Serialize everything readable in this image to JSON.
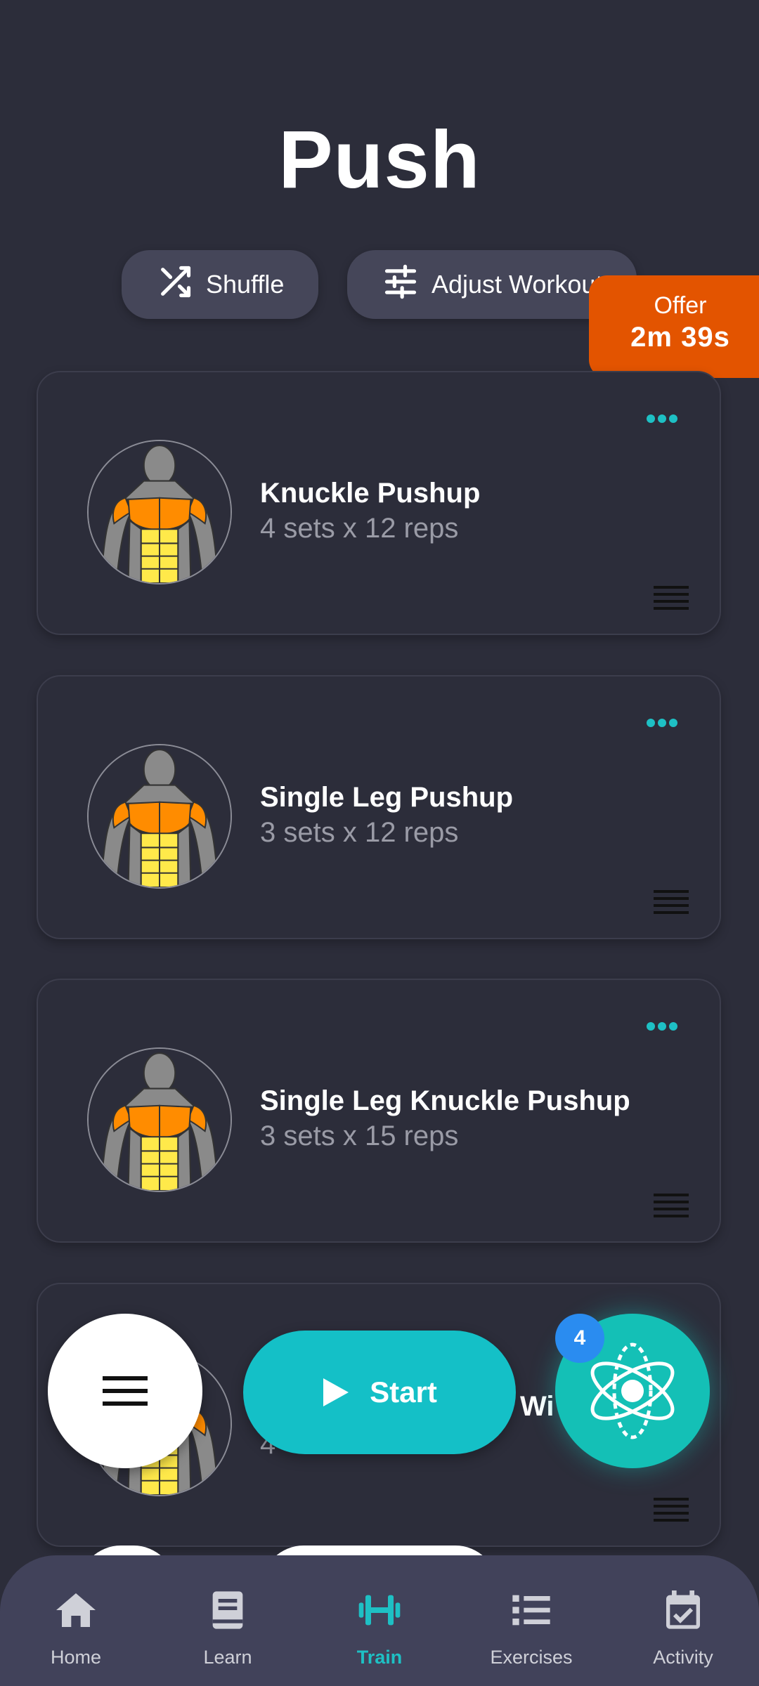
{
  "page": {
    "title": "Push"
  },
  "actions": {
    "shuffle_label": "Shuffle",
    "adjust_label": "Adjust Workout"
  },
  "offer": {
    "label": "Offer",
    "timer": "2m  39s"
  },
  "exercises": [
    {
      "name": "Knuckle Pushup",
      "detail": "4 sets x 12 reps"
    },
    {
      "name": "Single Leg Pushup",
      "detail": "3 sets x 12 reps"
    },
    {
      "name": "Single Leg Knuckle Pushup",
      "detail": "3 sets x 15 reps"
    },
    {
      "name": "Wi",
      "detail": "4"
    }
  ],
  "fab": {
    "start_label": "Start",
    "badge_count": "4"
  },
  "bottom_nav": {
    "items": [
      {
        "label": "Home",
        "icon": "home-icon"
      },
      {
        "label": "Learn",
        "icon": "book-icon"
      },
      {
        "label": "Train",
        "icon": "dumbbell-icon",
        "active": true
      },
      {
        "label": "Exercises",
        "icon": "list-icon"
      },
      {
        "label": "Activity",
        "icon": "calendar-check-icon"
      }
    ]
  },
  "colors": {
    "background": "#2c2d3a",
    "accent": "#14c0c7",
    "offer": "#e35400",
    "badge": "#2a8cf0",
    "nav_background": "#41425a"
  }
}
